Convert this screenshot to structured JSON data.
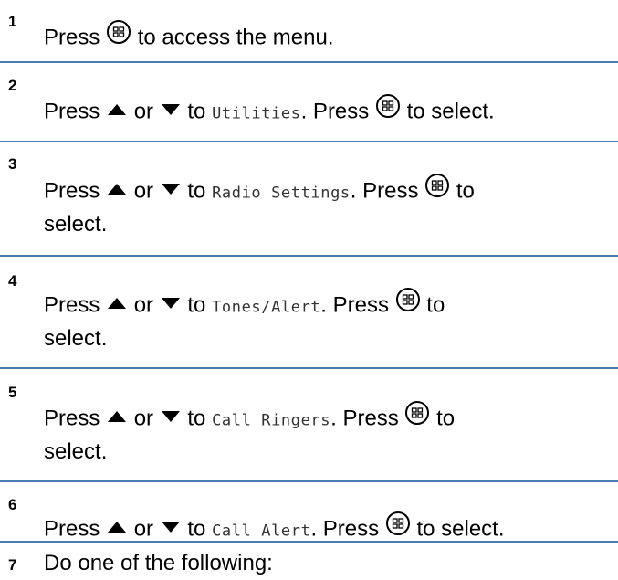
{
  "steps": [
    {
      "number": "1",
      "parts": [
        "Press",
        "to access the menu."
      ]
    },
    {
      "number": "2",
      "parts": [
        "Press",
        "or",
        "to",
        "Utilities",
        ". Press",
        "to select."
      ]
    },
    {
      "number": "3",
      "parts": [
        "Press",
        "or",
        "to",
        "Radio Settings",
        ". Press",
        "to",
        "select."
      ]
    },
    {
      "number": "4",
      "parts": [
        "Press",
        "or",
        "to",
        "Tones/Alert",
        ". Press",
        "to",
        "select."
      ]
    },
    {
      "number": "5",
      "parts": [
        "Press",
        "or",
        "to",
        "Call Ringers",
        ". Press",
        "to",
        "select."
      ]
    },
    {
      "number": "6",
      "parts": [
        "Press",
        "or",
        "to",
        "Call Alert",
        ". Press",
        "to select."
      ]
    },
    {
      "number": "7",
      "parts": [
        "Do one of the following:"
      ]
    }
  ],
  "icons": {
    "menu_ok": "menu-ok-button-icon",
    "up": "up-arrow-icon",
    "down": "down-arrow-icon"
  },
  "colors": {
    "rule": "#4a7bb3"
  }
}
